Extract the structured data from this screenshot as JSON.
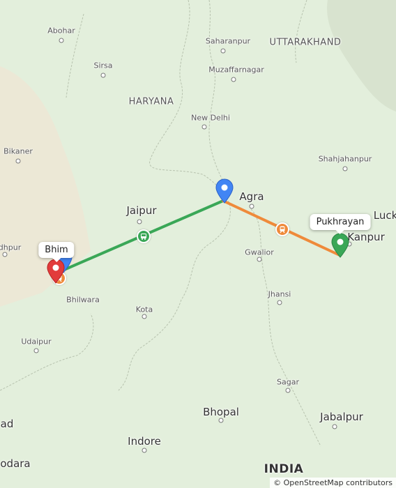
{
  "map": {
    "colors": {
      "land": "#e3efdc",
      "desert": "#ece8d6",
      "mountain": "#d8e3cf",
      "border": "#b7c2ae",
      "route_green": "#3aa757",
      "route_orange": "#ef8a3a",
      "pin_blue": "#4285f4",
      "pin_red": "#e23b3b",
      "pin_green": "#3aa757"
    },
    "labels": {
      "abohar": "Abohar",
      "sirsa": "Sirsa",
      "haryana": "HARYANA",
      "bikaner": "Bikaner",
      "saharanpur": "Saharanpur",
      "uttarakhand": "UTTARAKHAND",
      "muzaffarnagar": "Muzaffarnagar",
      "new_delhi": "New Delhi",
      "shahjahanpur": "Shahjahanpur",
      "agra": "Agra",
      "luck": "Luck",
      "jaipur": "Jaipur",
      "kanpur": "Kanpur",
      "jodhpur": "dhpur",
      "gwalior": "Gwalior",
      "bhilwara": "Bhilwara",
      "jhansi": "Jhansi",
      "kota": "Kota",
      "udaipur": "Udaipur",
      "sagar": "Sagar",
      "bhopal": "Bhopal",
      "jabalpur": "Jabalpur",
      "ahmedabad": "ad",
      "indore": "Indore",
      "vadodara": "odara",
      "india": "INDIA"
    },
    "callouts": {
      "bhim": "Bhim",
      "pukhrayan": "Pukhrayan"
    },
    "pins": [
      {
        "name": "Bhim",
        "color": "red",
        "role": "start"
      },
      {
        "name": "Agra",
        "color": "blue",
        "role": "waypoint"
      },
      {
        "name": "Pukhrayan",
        "color": "green",
        "role": "destination"
      }
    ],
    "route_segments": [
      {
        "from": "Bhim",
        "to": "Agra",
        "color": "green",
        "icon": "bus-icon"
      },
      {
        "from": "Agra",
        "to": "Pukhrayan",
        "color": "orange",
        "icon": "train-icon"
      }
    ],
    "attribution": "© OpenStreetMap contributors"
  }
}
